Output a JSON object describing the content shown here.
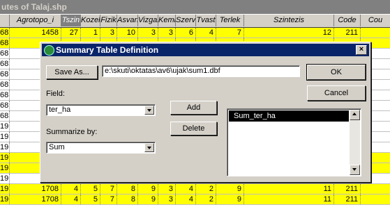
{
  "background_table": {
    "title": "utes of Talaj.shp",
    "columns": [
      "",
      "Agrotopo_i",
      "Tszin",
      "Kozel",
      "Fizik",
      "Asvany",
      "Vizgaz",
      "Kemh",
      "Szerv",
      "Tvast",
      "Terlek",
      "Szintezis",
      "Code",
      "Cou"
    ],
    "rows": [
      {
        "cells": [
          "68",
          "1458",
          "27",
          "1",
          "3",
          "10",
          "3",
          "3",
          "6",
          "4",
          "7",
          "12",
          "211",
          ""
        ],
        "highlight": true
      },
      {
        "cells": [
          "68",
          "",
          "",
          "",
          "",
          "",
          "",
          "",
          "",
          "",
          "",
          "",
          "",
          ""
        ],
        "highlight": true
      },
      {
        "cells": [
          "68",
          "",
          "",
          "",
          "",
          "",
          "",
          "",
          "",
          "",
          "",
          "",
          "",
          ""
        ],
        "highlight": false
      },
      {
        "cells": [
          "68",
          "",
          "",
          "",
          "",
          "",
          "",
          "",
          "",
          "",
          "",
          "",
          "",
          ""
        ],
        "highlight": false
      },
      {
        "cells": [
          "68",
          "",
          "",
          "",
          "",
          "",
          "",
          "",
          "",
          "",
          "",
          "",
          "",
          ""
        ],
        "highlight": false
      },
      {
        "cells": [
          "68",
          "",
          "",
          "",
          "",
          "",
          "",
          "",
          "",
          "",
          "",
          "",
          "",
          ""
        ],
        "highlight": false
      },
      {
        "cells": [
          "68",
          "",
          "",
          "",
          "",
          "",
          "",
          "",
          "",
          "",
          "",
          "",
          "",
          ""
        ],
        "highlight": false
      },
      {
        "cells": [
          "68",
          "",
          "",
          "",
          "",
          "",
          "",
          "",
          "",
          "",
          "",
          "",
          "",
          ""
        ],
        "highlight": false
      },
      {
        "cells": [
          "68",
          "",
          "",
          "",
          "",
          "",
          "",
          "",
          "",
          "",
          "",
          "",
          "",
          ""
        ],
        "highlight": false
      },
      {
        "cells": [
          "19",
          "",
          "",
          "",
          "",
          "",
          "",
          "",
          "",
          "",
          "",
          "",
          "",
          ""
        ],
        "highlight": false
      },
      {
        "cells": [
          "19",
          "",
          "",
          "",
          "",
          "",
          "",
          "",
          "",
          "",
          "",
          "",
          "",
          ""
        ],
        "highlight": false
      },
      {
        "cells": [
          "19",
          "",
          "",
          "",
          "",
          "",
          "",
          "",
          "",
          "",
          "",
          "",
          "",
          ""
        ],
        "highlight": false
      },
      {
        "cells": [
          "19",
          "",
          "",
          "",
          "",
          "",
          "",
          "",
          "",
          "",
          "",
          "",
          "",
          ""
        ],
        "highlight": true
      },
      {
        "cells": [
          "19",
          "",
          "",
          "",
          "",
          "",
          "",
          "",
          "",
          "",
          "",
          "",
          "",
          ""
        ],
        "highlight": true
      },
      {
        "cells": [
          "19",
          "",
          "",
          "",
          "",
          "",
          "",
          "",
          "",
          "",
          "",
          "",
          "",
          ""
        ],
        "highlight": false
      },
      {
        "cells": [
          "19",
          "1708",
          "4",
          "5",
          "7",
          "8",
          "9",
          "3",
          "4",
          "2",
          "9",
          "11",
          "211",
          ""
        ],
        "highlight": true
      },
      {
        "cells": [
          "19",
          "1708",
          "4",
          "5",
          "7",
          "8",
          "9",
          "3",
          "4",
          "2",
          "9",
          "11",
          "211",
          ""
        ],
        "highlight": true
      }
    ]
  },
  "dialog": {
    "title": "Summary Table Definition",
    "save_as_label": "Save As...",
    "output_path": "e:\\skuti\\oktatas\\av6\\ujak\\sum1.dbf",
    "ok_label": "OK",
    "cancel_label": "Cancel",
    "field_label": "Field:",
    "field_value": "ter_ha",
    "summarize_label": "Summarize by:",
    "summarize_value": "Sum",
    "add_label": "Add",
    "delete_label": "Delete",
    "list_items": [
      "Sum_ter_ha"
    ],
    "close_glyph": "×"
  }
}
